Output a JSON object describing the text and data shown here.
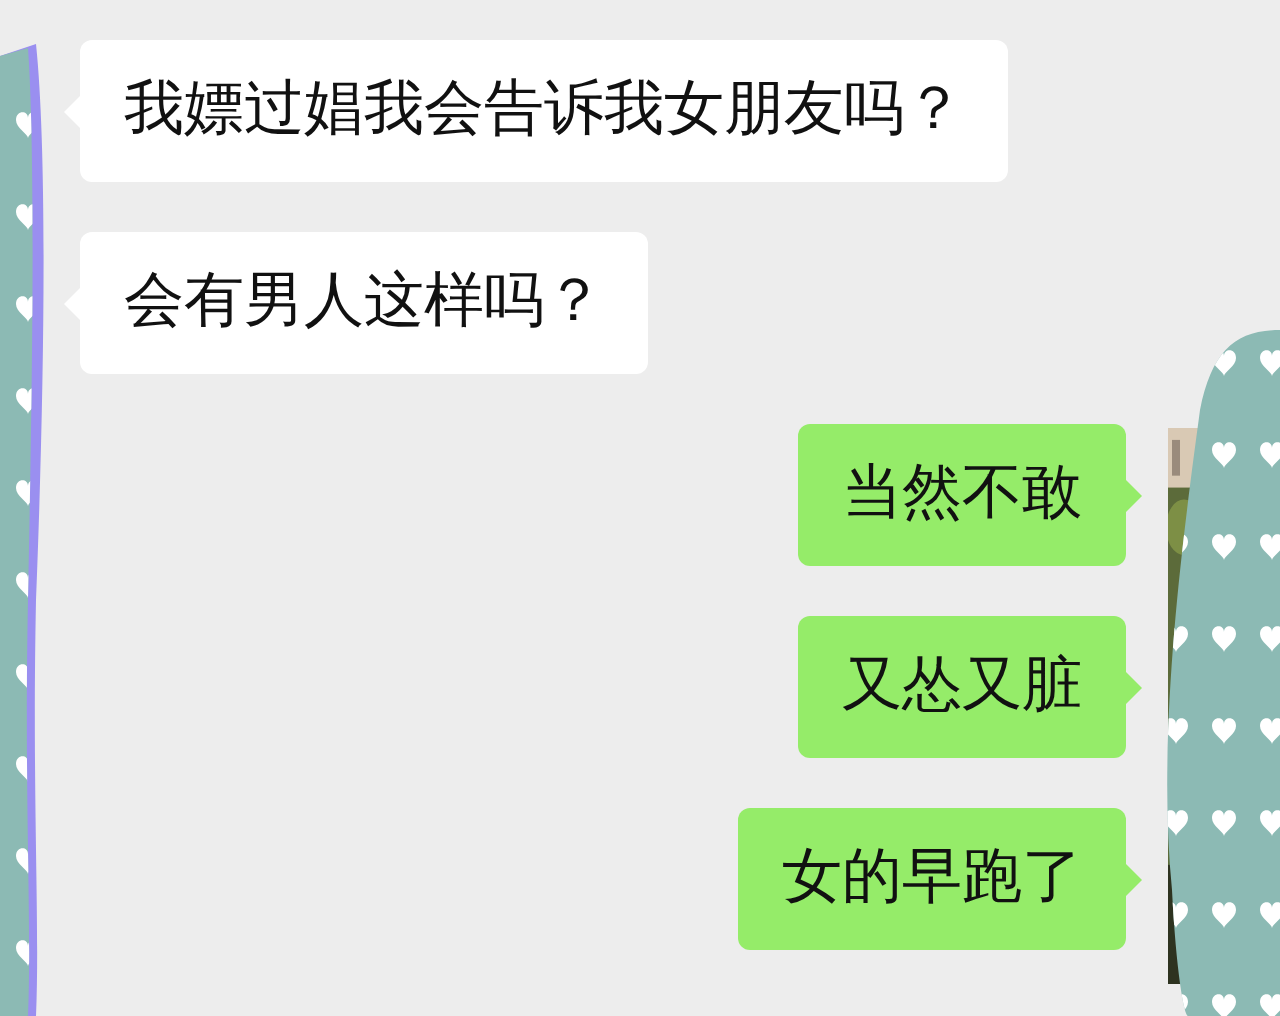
{
  "messages": [
    {
      "kind": "received",
      "text": "我嫖过娼我会告诉我女朋友吗？"
    },
    {
      "kind": "received",
      "text": "会有男人这样吗？"
    },
    {
      "kind": "sent",
      "text": "当然不敢"
    },
    {
      "kind": "sent",
      "text": "又怂又脏"
    },
    {
      "kind": "sent",
      "text": "女的早跑了"
    }
  ]
}
